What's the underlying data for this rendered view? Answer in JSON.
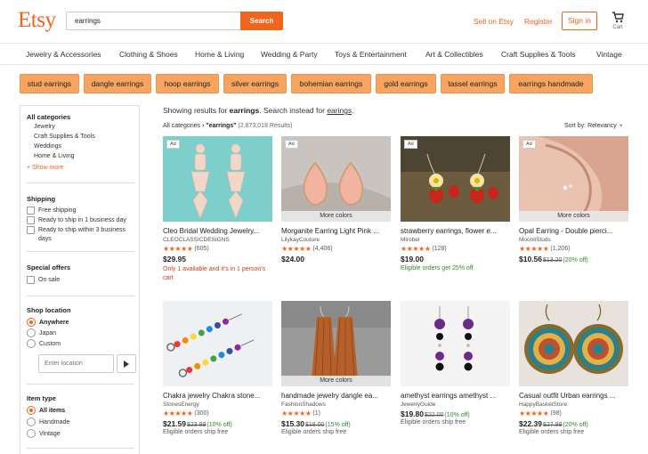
{
  "header": {
    "logo": "Etsy",
    "search_value": "earrings",
    "search_button": "Search",
    "sell": "Sell on Etsy",
    "register": "Register",
    "signin": "Sign in",
    "cart": "Cart"
  },
  "categories": [
    "Jewelry & Accessories",
    "Clothing & Shoes",
    "Home & Living",
    "Wedding & Party",
    "Toys & Entertainment",
    "Art & Collectibles",
    "Craft Supplies & Tools",
    "Vintage"
  ],
  "suggestions": [
    "stud earrings",
    "dangle earrings",
    "hoop earrings",
    "silver earrings",
    "bohemian earrings",
    "gold earrings",
    "tassel earrings",
    "earrings handmade"
  ],
  "sidebar": {
    "all_categories": "All categories",
    "category_links": [
      "Jewelry",
      "Craft Supplies & Tools",
      "Weddings",
      "Home & Living"
    ],
    "show_more": "+ Show more",
    "shipping_title": "Shipping",
    "shipping_options": [
      "Free shipping",
      "Ready to ship in 1 business day",
      "Ready to ship within 3 business days"
    ],
    "offers_title": "Special offers",
    "offers_options": [
      "On sale"
    ],
    "location_title": "Shop location",
    "location_options": [
      "Anywhere",
      "Japan",
      "Custom"
    ],
    "location_placeholder": "Enter location",
    "item_type_title": "Item type",
    "item_type_options": [
      "All items",
      "Handmade",
      "Vintage"
    ]
  },
  "results": {
    "showing_prefix": "Showing results for",
    "query": "earrings",
    "instead_prefix": ". Search instead for",
    "instead_term": "earings",
    "instead_suffix": ".",
    "crumb_category": "All categories",
    "crumb_query": "\"earrings\"",
    "crumb_count": "(2,873,018 Results)",
    "sort_label": "Sort by: Relevancy"
  },
  "listings": [
    {
      "title": "Cleo Bridal Wedding Jewelry...",
      "shop": "CLEOCLASSICDESIGNS",
      "stars": "★★★★★",
      "reviews": "(605)",
      "price": "$29.95",
      "old_price": "",
      "discount": "",
      "note": "Only 1 available and it's in 1 person's cart",
      "note2": "",
      "ad": "Ad",
      "more_colors": ""
    },
    {
      "title": "Morganite Earring Light Pink ...",
      "shop": "LilykayCouture",
      "stars": "★★★★★",
      "reviews": "(4,406)",
      "price": "$24.00",
      "old_price": "",
      "discount": "",
      "note": "",
      "note2": "",
      "ad": "Ad",
      "more_colors": "More colors"
    },
    {
      "title": "strawberry earrings, flower e...",
      "shop": "Mirobel",
      "stars": "★★★★★",
      "reviews": "(128)",
      "price": "$19.00",
      "old_price": "",
      "discount": "",
      "note": "Eligible orders get 25% off",
      "note2": "",
      "ad": "Ad",
      "more_colors": ""
    },
    {
      "title": "Opal Earring - Double pierci...",
      "shop": "MoonliStuds",
      "stars": "★★★★★",
      "reviews": "(1,206)",
      "price": "$10.56",
      "old_price": "$13.20",
      "discount": "(20% off)",
      "note": "",
      "note2": "",
      "ad": "Ad",
      "more_colors": "More colors"
    },
    {
      "title": "Chakra jewelry Chakra stone...",
      "shop": "StonesEnergy",
      "stars": "★★★★★",
      "reviews": "(300)",
      "price": "$21.59",
      "old_price": "$23.99",
      "discount": "(10% off)",
      "note": "",
      "note2": "Eligible orders ship free",
      "ad": "",
      "more_colors": ""
    },
    {
      "title": "handmade jewelry dangle ea...",
      "shop": "FashionShadows",
      "stars": "★★★★★",
      "reviews": "(1)",
      "price": "$15.30",
      "old_price": "$18.00",
      "discount": "(15% off)",
      "note": "",
      "note2": "Eligible orders ship free",
      "ad": "",
      "more_colors": "More colors"
    },
    {
      "title": "amethyst earrings amethyst ...",
      "shop": "JewelryGuide",
      "stars": "",
      "reviews": "",
      "price": "$19.80",
      "old_price": "$22.00",
      "discount": "(10% off)",
      "note": "",
      "note2": "Eligible orders ship free",
      "ad": "",
      "more_colors": ""
    },
    {
      "title": "Casual outfit Urban earrings ...",
      "shop": "HappyBasketStore",
      "stars": "★★★★★",
      "reviews": "(98)",
      "price": "$22.39",
      "old_price": "$27.99",
      "discount": "(20% off)",
      "note": "",
      "note2": "Eligible orders ship free",
      "ad": "",
      "more_colors": ""
    }
  ],
  "colors": {
    "brand": "#f1641e",
    "pill": "#f6a45f",
    "sale_green": "#2f8a2f",
    "alert_red": "#d63b17"
  }
}
